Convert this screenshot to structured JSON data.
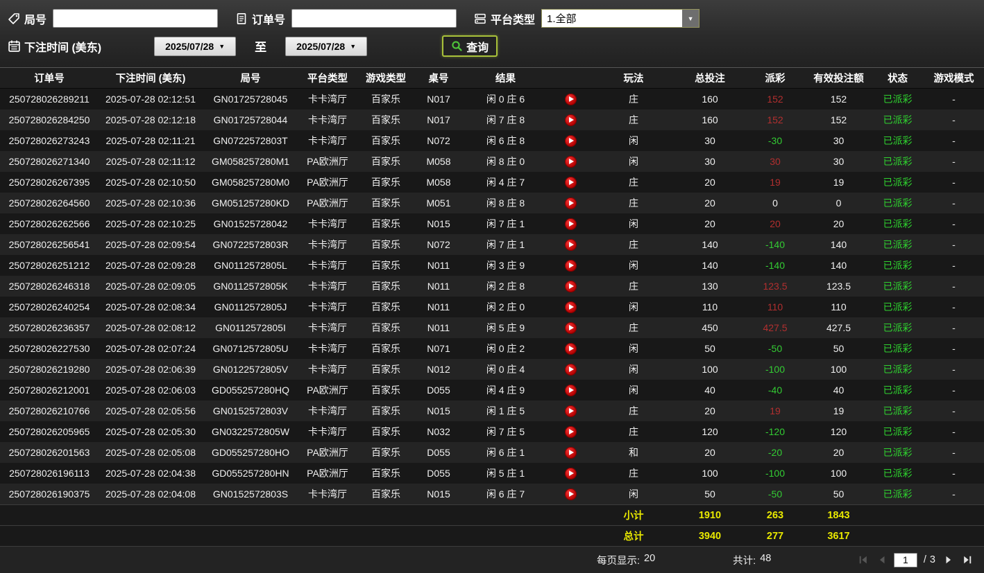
{
  "filters": {
    "round_label": "局号",
    "order_label": "订单号",
    "platform_label": "平台类型",
    "platform_value": "1.全部",
    "bet_time_label": "下注时间 (美东)",
    "date_from": "2025/07/28",
    "date_to": "2025/07/28",
    "to_label": "至",
    "query_label": "查询"
  },
  "glyphs": {
    "caret_down": "▼"
  },
  "colors": {
    "win_red": "#b22f2f",
    "loss_green": "#33cc33",
    "status_green": "#2fd32f",
    "summary_yellow": "#e9e900",
    "query_border": "#a9c23a",
    "play_icon_red": "#cc0000"
  },
  "table": {
    "headers": [
      "订单号",
      "下注时间 (美东)",
      "局号",
      "平台类型",
      "游戏类型",
      "桌号",
      "结果",
      "",
      "玩法",
      "总投注",
      "派彩",
      "有效投注额",
      "状态",
      "游戏模式"
    ],
    "rows": [
      {
        "order_id": "250728026289211",
        "bet_time": "2025-07-28 02:12:51",
        "round_id": "GN01725728045",
        "platform": "卡卡湾厅",
        "game_type": "百家乐",
        "table_no": "N017",
        "result": "闲 0 庄 6",
        "play_type": "庄",
        "total_bet": "160",
        "payout": "152",
        "valid_bet": "152",
        "status": "已派彩",
        "mode": "-"
      },
      {
        "order_id": "250728026284250",
        "bet_time": "2025-07-28 02:12:18",
        "round_id": "GN01725728044",
        "platform": "卡卡湾厅",
        "game_type": "百家乐",
        "table_no": "N017",
        "result": "闲 7 庄 8",
        "play_type": "庄",
        "total_bet": "160",
        "payout": "152",
        "valid_bet": "152",
        "status": "已派彩",
        "mode": "-"
      },
      {
        "order_id": "250728026273243",
        "bet_time": "2025-07-28 02:11:21",
        "round_id": "GN0722572803T",
        "platform": "卡卡湾厅",
        "game_type": "百家乐",
        "table_no": "N072",
        "result": "闲 6 庄 8",
        "play_type": "闲",
        "total_bet": "30",
        "payout": "-30",
        "valid_bet": "30",
        "status": "已派彩",
        "mode": "-"
      },
      {
        "order_id": "250728026271340",
        "bet_time": "2025-07-28 02:11:12",
        "round_id": "GM058257280M1",
        "platform": "PA欧洲厅",
        "game_type": "百家乐",
        "table_no": "M058",
        "result": "闲 8 庄 0",
        "play_type": "闲",
        "total_bet": "30",
        "payout": "30",
        "valid_bet": "30",
        "status": "已派彩",
        "mode": "-"
      },
      {
        "order_id": "250728026267395",
        "bet_time": "2025-07-28 02:10:50",
        "round_id": "GM058257280M0",
        "platform": "PA欧洲厅",
        "game_type": "百家乐",
        "table_no": "M058",
        "result": "闲 4 庄 7",
        "play_type": "庄",
        "total_bet": "20",
        "payout": "19",
        "valid_bet": "19",
        "status": "已派彩",
        "mode": "-"
      },
      {
        "order_id": "250728026264560",
        "bet_time": "2025-07-28 02:10:36",
        "round_id": "GM051257280KD",
        "platform": "PA欧洲厅",
        "game_type": "百家乐",
        "table_no": "M051",
        "result": "闲 8 庄 8",
        "play_type": "庄",
        "total_bet": "20",
        "payout": "0",
        "valid_bet": "0",
        "status": "已派彩",
        "mode": "-"
      },
      {
        "order_id": "250728026262566",
        "bet_time": "2025-07-28 02:10:25",
        "round_id": "GN01525728042",
        "platform": "卡卡湾厅",
        "game_type": "百家乐",
        "table_no": "N015",
        "result": "闲 7 庄 1",
        "play_type": "闲",
        "total_bet": "20",
        "payout": "20",
        "valid_bet": "20",
        "status": "已派彩",
        "mode": "-"
      },
      {
        "order_id": "250728026256541",
        "bet_time": "2025-07-28 02:09:54",
        "round_id": "GN0722572803R",
        "platform": "卡卡湾厅",
        "game_type": "百家乐",
        "table_no": "N072",
        "result": "闲 7 庄 1",
        "play_type": "庄",
        "total_bet": "140",
        "payout": "-140",
        "valid_bet": "140",
        "status": "已派彩",
        "mode": "-"
      },
      {
        "order_id": "250728026251212",
        "bet_time": "2025-07-28 02:09:28",
        "round_id": "GN0112572805L",
        "platform": "卡卡湾厅",
        "game_type": "百家乐",
        "table_no": "N011",
        "result": "闲 3 庄 9",
        "play_type": "闲",
        "total_bet": "140",
        "payout": "-140",
        "valid_bet": "140",
        "status": "已派彩",
        "mode": "-"
      },
      {
        "order_id": "250728026246318",
        "bet_time": "2025-07-28 02:09:05",
        "round_id": "GN0112572805K",
        "platform": "卡卡湾厅",
        "game_type": "百家乐",
        "table_no": "N011",
        "result": "闲 2 庄 8",
        "play_type": "庄",
        "total_bet": "130",
        "payout": "123.5",
        "valid_bet": "123.5",
        "status": "已派彩",
        "mode": "-"
      },
      {
        "order_id": "250728026240254",
        "bet_time": "2025-07-28 02:08:34",
        "round_id": "GN0112572805J",
        "platform": "卡卡湾厅",
        "game_type": "百家乐",
        "table_no": "N011",
        "result": "闲 2 庄 0",
        "play_type": "闲",
        "total_bet": "110",
        "payout": "110",
        "valid_bet": "110",
        "status": "已派彩",
        "mode": "-"
      },
      {
        "order_id": "250728026236357",
        "bet_time": "2025-07-28 02:08:12",
        "round_id": "GN0112572805I",
        "platform": "卡卡湾厅",
        "game_type": "百家乐",
        "table_no": "N011",
        "result": "闲 5 庄 9",
        "play_type": "庄",
        "total_bet": "450",
        "payout": "427.5",
        "valid_bet": "427.5",
        "status": "已派彩",
        "mode": "-"
      },
      {
        "order_id": "250728026227530",
        "bet_time": "2025-07-28 02:07:24",
        "round_id": "GN0712572805U",
        "platform": "卡卡湾厅",
        "game_type": "百家乐",
        "table_no": "N071",
        "result": "闲 0 庄 2",
        "play_type": "闲",
        "total_bet": "50",
        "payout": "-50",
        "valid_bet": "50",
        "status": "已派彩",
        "mode": "-"
      },
      {
        "order_id": "250728026219280",
        "bet_time": "2025-07-28 02:06:39",
        "round_id": "GN0122572805V",
        "platform": "卡卡湾厅",
        "game_type": "百家乐",
        "table_no": "N012",
        "result": "闲 0 庄 4",
        "play_type": "闲",
        "total_bet": "100",
        "payout": "-100",
        "valid_bet": "100",
        "status": "已派彩",
        "mode": "-"
      },
      {
        "order_id": "250728026212001",
        "bet_time": "2025-07-28 02:06:03",
        "round_id": "GD055257280HQ",
        "platform": "PA欧洲厅",
        "game_type": "百家乐",
        "table_no": "D055",
        "result": "闲 4 庄 9",
        "play_type": "闲",
        "total_bet": "40",
        "payout": "-40",
        "valid_bet": "40",
        "status": "已派彩",
        "mode": "-"
      },
      {
        "order_id": "250728026210766",
        "bet_time": "2025-07-28 02:05:56",
        "round_id": "GN0152572803V",
        "platform": "卡卡湾厅",
        "game_type": "百家乐",
        "table_no": "N015",
        "result": "闲 1 庄 5",
        "play_type": "庄",
        "total_bet": "20",
        "payout": "19",
        "valid_bet": "19",
        "status": "已派彩",
        "mode": "-"
      },
      {
        "order_id": "250728026205965",
        "bet_time": "2025-07-28 02:05:30",
        "round_id": "GN0322572805W",
        "platform": "卡卡湾厅",
        "game_type": "百家乐",
        "table_no": "N032",
        "result": "闲 7 庄 5",
        "play_type": "庄",
        "total_bet": "120",
        "payout": "-120",
        "valid_bet": "120",
        "status": "已派彩",
        "mode": "-"
      },
      {
        "order_id": "250728026201563",
        "bet_time": "2025-07-28 02:05:08",
        "round_id": "GD055257280HO",
        "platform": "PA欧洲厅",
        "game_type": "百家乐",
        "table_no": "D055",
        "result": "闲 6 庄 1",
        "play_type": "和",
        "total_bet": "20",
        "payout": "-20",
        "valid_bet": "20",
        "status": "已派彩",
        "mode": "-"
      },
      {
        "order_id": "250728026196113",
        "bet_time": "2025-07-28 02:04:38",
        "round_id": "GD055257280HN",
        "platform": "PA欧洲厅",
        "game_type": "百家乐",
        "table_no": "D055",
        "result": "闲 5 庄 1",
        "play_type": "庄",
        "total_bet": "100",
        "payout": "-100",
        "valid_bet": "100",
        "status": "已派彩",
        "mode": "-"
      },
      {
        "order_id": "250728026190375",
        "bet_time": "2025-07-28 02:04:08",
        "round_id": "GN0152572803S",
        "platform": "卡卡湾厅",
        "game_type": "百家乐",
        "table_no": "N015",
        "result": "闲 6 庄 7",
        "play_type": "闲",
        "total_bet": "50",
        "payout": "-50",
        "valid_bet": "50",
        "status": "已派彩",
        "mode": "-"
      }
    ]
  },
  "summary": {
    "subtotal_label": "小计",
    "subtotal": {
      "total_bet": "1910",
      "payout": "263",
      "valid_bet": "1843"
    },
    "total_label": "总计",
    "total": {
      "total_bet": "3940",
      "payout": "277",
      "valid_bet": "3617"
    }
  },
  "footer": {
    "per_page_label": "每页显示:",
    "per_page": "20",
    "total_label": "共计:",
    "total_count": "48",
    "current_page": "1",
    "page_sep": "/",
    "total_pages": "3"
  }
}
